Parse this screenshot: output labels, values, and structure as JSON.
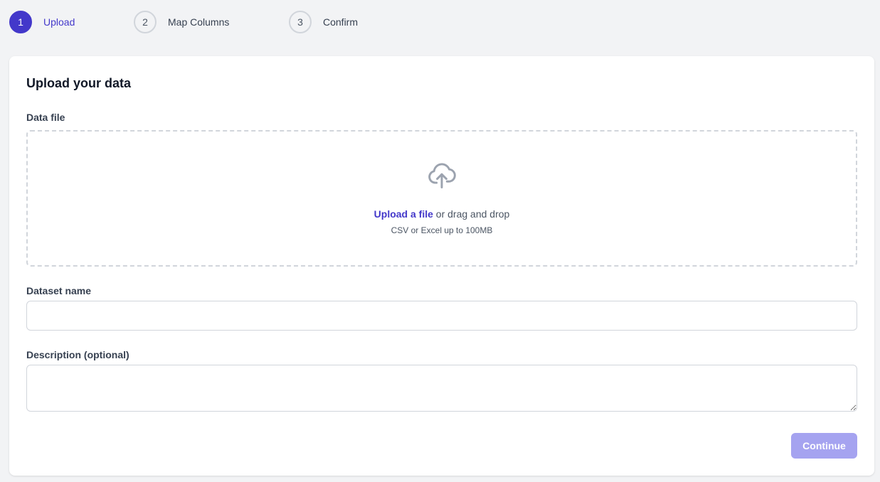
{
  "stepper": {
    "steps": [
      {
        "number": "1",
        "label": "Upload",
        "state": "active"
      },
      {
        "number": "2",
        "label": "Map Columns",
        "state": "inactive"
      },
      {
        "number": "3",
        "label": "Confirm",
        "state": "inactive"
      }
    ]
  },
  "form": {
    "title": "Upload your data",
    "data_file": {
      "label": "Data file",
      "upload_link": "Upload a file",
      "drag_text": " or drag and drop",
      "hint": "CSV or Excel up to 100MB",
      "icon": "cloud-upload-icon"
    },
    "dataset_name": {
      "label": "Dataset name",
      "value": "",
      "placeholder": ""
    },
    "description": {
      "label": "Description (optional)",
      "value": "",
      "placeholder": ""
    },
    "continue_label": "Continue"
  },
  "colors": {
    "accent": "#4338ca",
    "button_disabled": "#a5a3f0",
    "background": "#f2f3f5"
  }
}
